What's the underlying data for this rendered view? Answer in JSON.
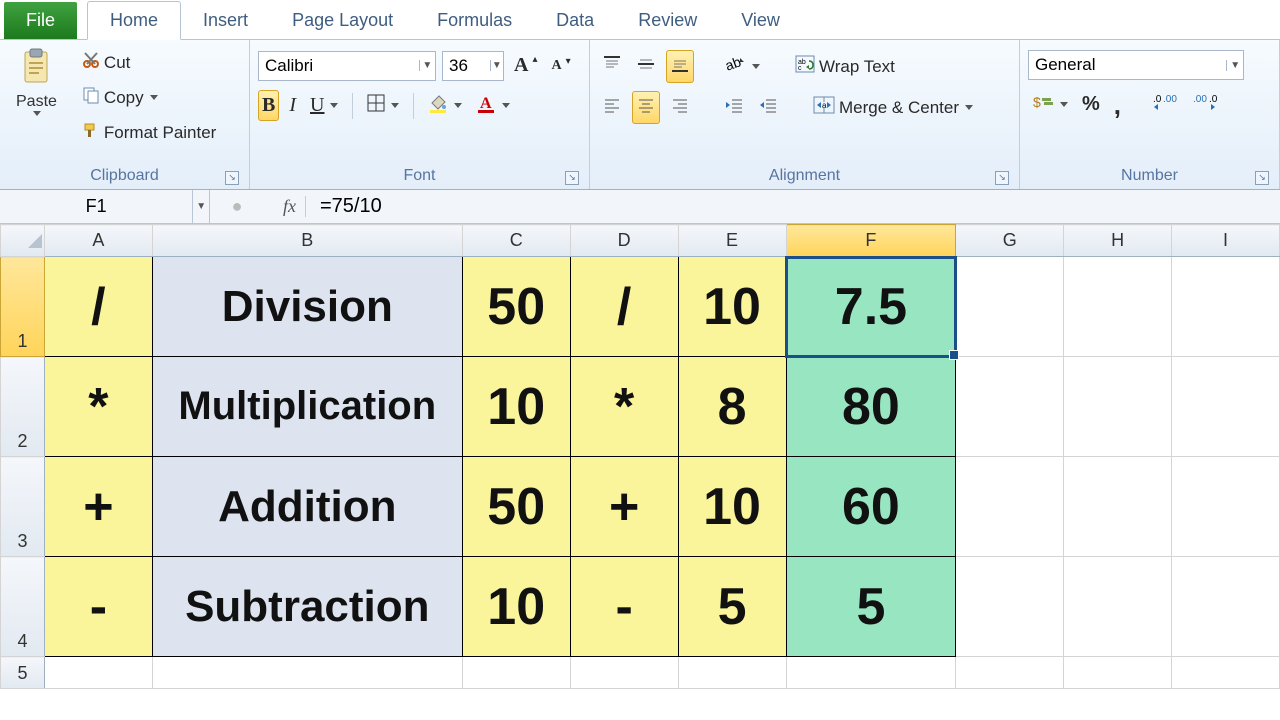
{
  "tabs": {
    "file": "File",
    "home": "Home",
    "insert": "Insert",
    "page_layout": "Page Layout",
    "formulas": "Formulas",
    "data": "Data",
    "review": "Review",
    "view": "View"
  },
  "ribbon": {
    "clipboard": {
      "label": "Clipboard",
      "paste": "Paste",
      "cut": "Cut",
      "copy": "Copy",
      "format_painter": "Format Painter"
    },
    "font": {
      "label": "Font",
      "name": "Calibri",
      "size": "36"
    },
    "alignment": {
      "label": "Alignment",
      "wrap": "Wrap Text",
      "merge": "Merge & Center"
    },
    "number": {
      "label": "Number",
      "format": "General"
    }
  },
  "formula_bar": {
    "cell_ref": "F1",
    "fx": "fx",
    "formula": "=75/10"
  },
  "columns": [
    "A",
    "B",
    "C",
    "D",
    "E",
    "F",
    "G",
    "H",
    "I"
  ],
  "row_labels": [
    "1",
    "2",
    "3",
    "4",
    "5"
  ],
  "sheet": {
    "selected": "F1",
    "rows": [
      {
        "A": "/",
        "B": "Division",
        "C": "50",
        "D": "/",
        "E": "10",
        "F": "7.5"
      },
      {
        "A": "*",
        "B": "Multiplication",
        "C": "10",
        "D": "*",
        "E": "8",
        "F": "80"
      },
      {
        "A": "+",
        "B": "Addition",
        "C": "50",
        "D": "+",
        "E": "10",
        "F": "60"
      },
      {
        "A": "-",
        "B": "Subtraction",
        "C": "10",
        "D": "-",
        "E": "5",
        "F": "5"
      }
    ]
  },
  "colors": {
    "yellow": "#faf49a",
    "lavender": "#dde3ef",
    "mint": "#98e6c1",
    "selection": "#1b4f8a"
  }
}
